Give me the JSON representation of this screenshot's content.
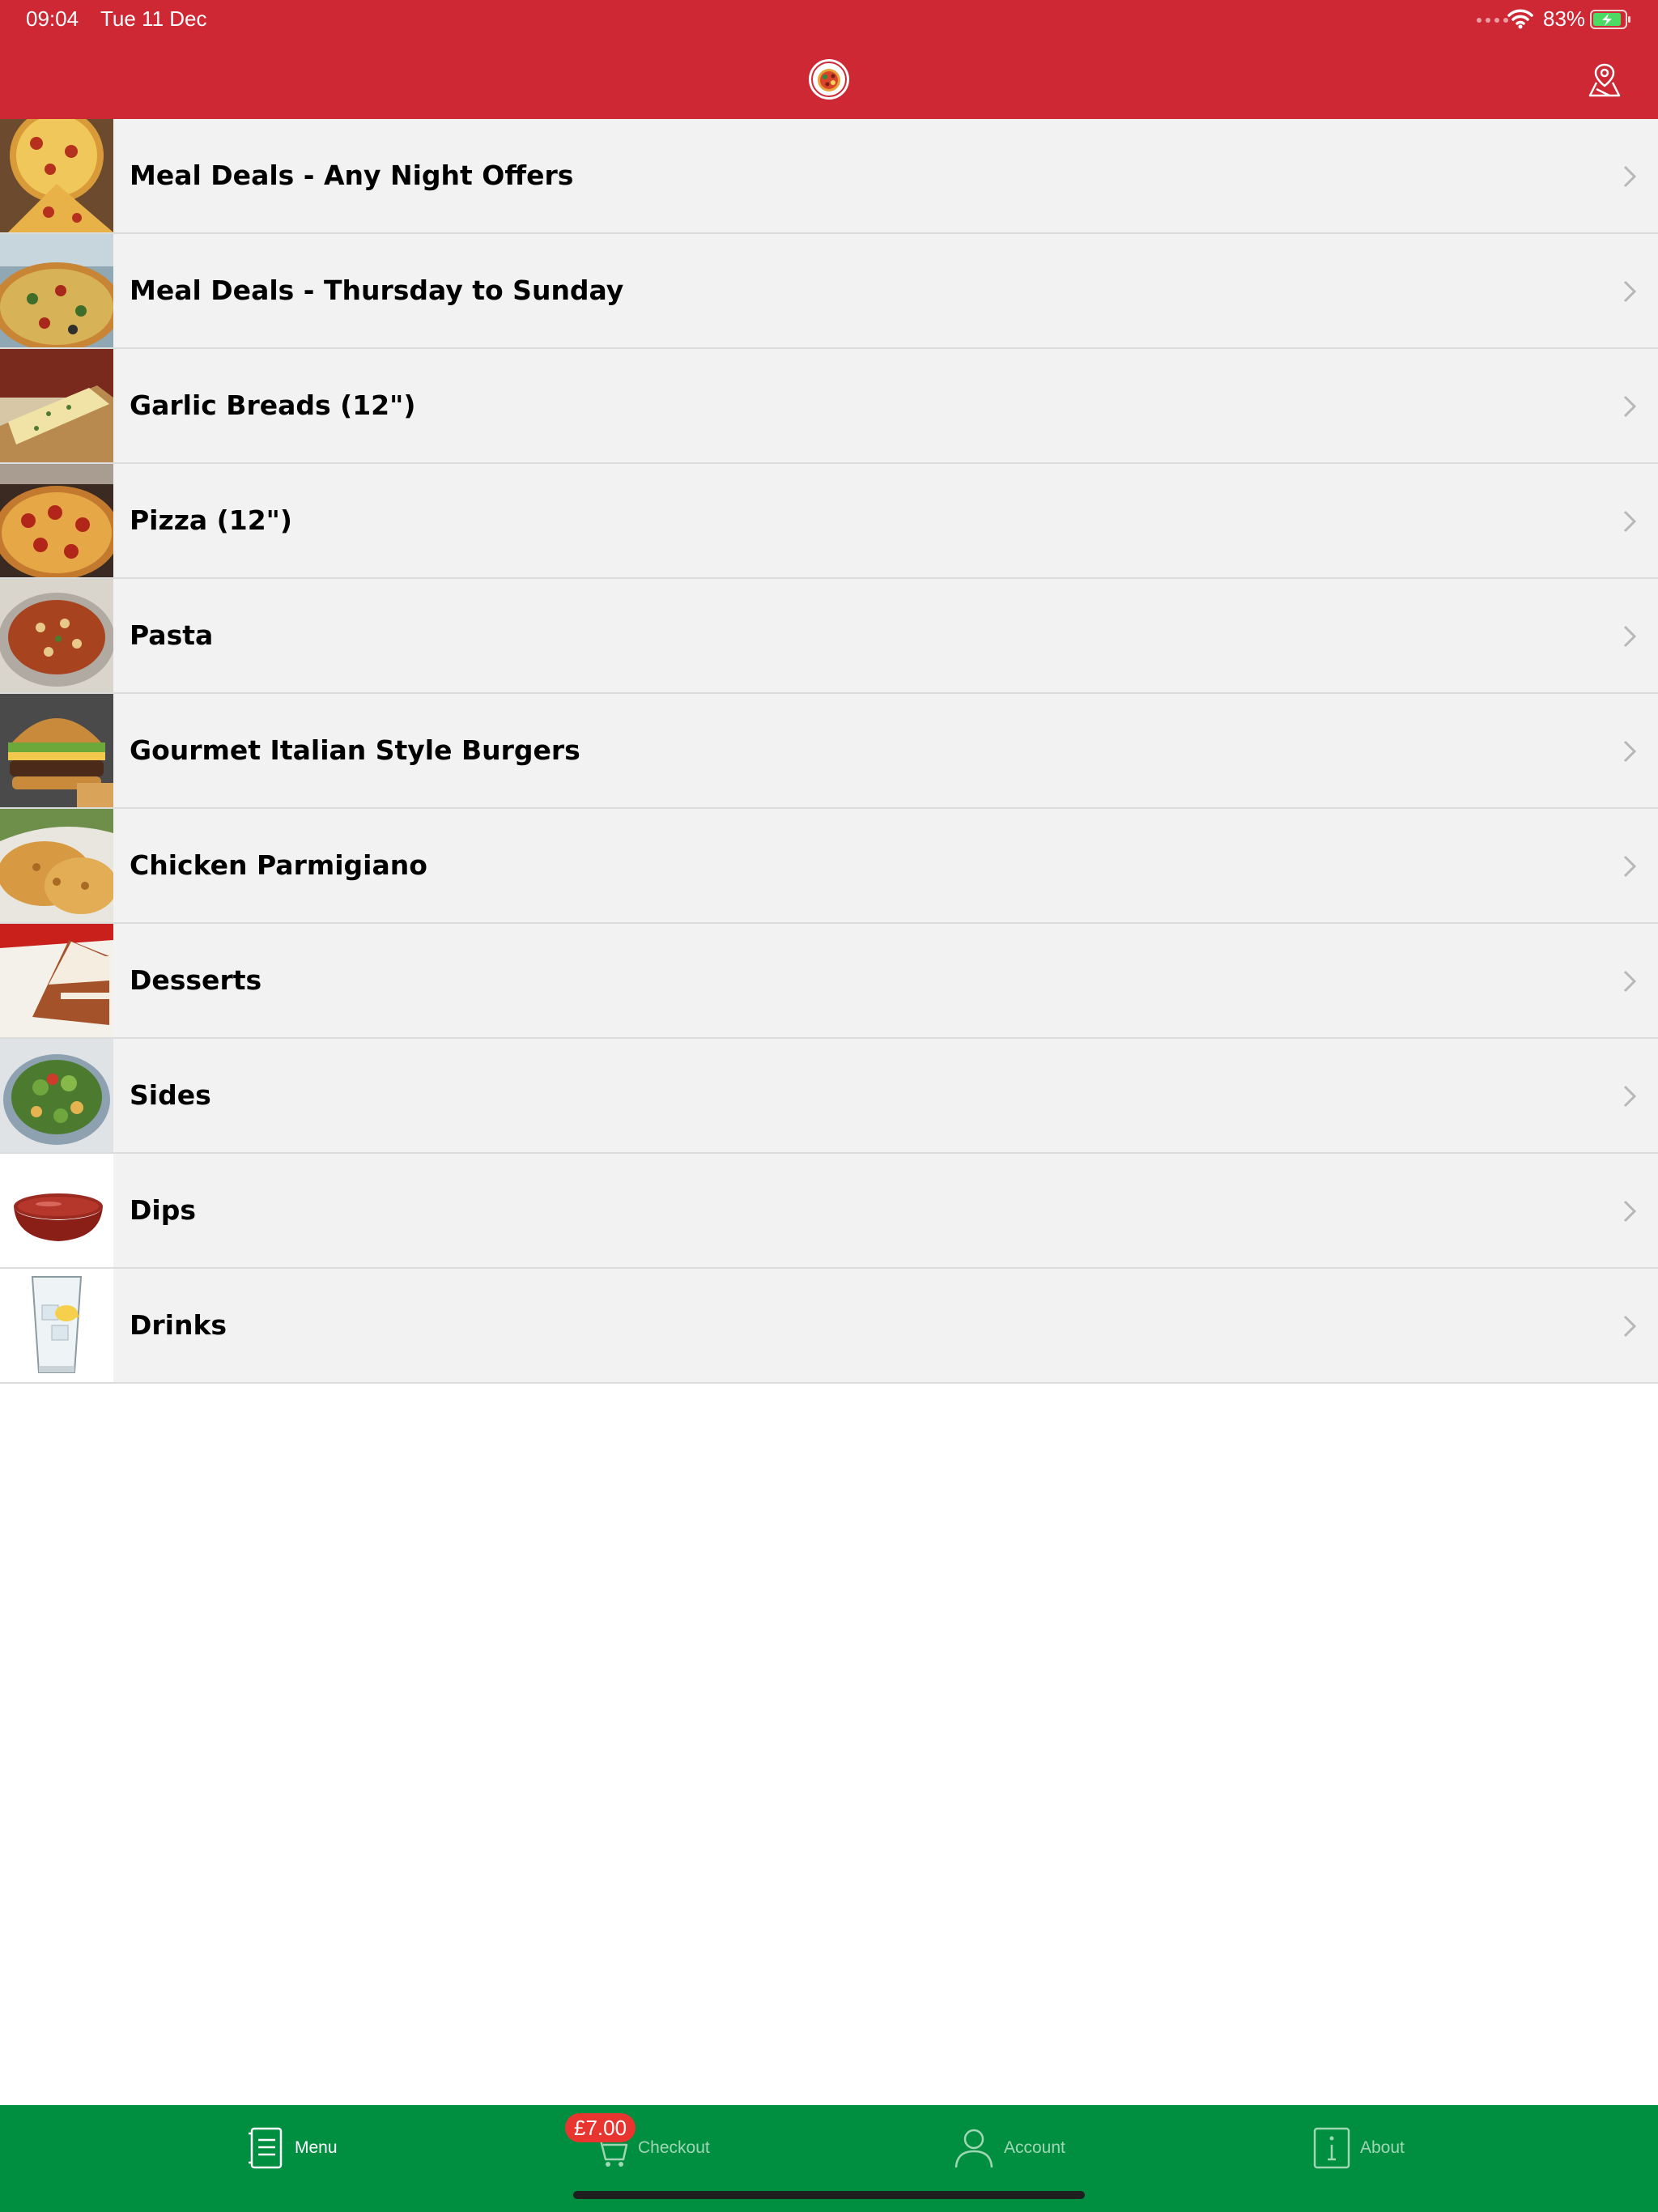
{
  "status_bar": {
    "time": "09:04",
    "date": "Tue 11 Dec",
    "battery": "83%"
  },
  "header": {
    "logo_icon": "pizza-logo-icon",
    "location_icon": "map-pin-icon"
  },
  "categories": [
    {
      "label": "Meal Deals - Any Night Offers",
      "thumb": "pizza-slices"
    },
    {
      "label": "Meal Deals - Thursday to Sunday",
      "thumb": "pizza-pan"
    },
    {
      "label": "Garlic Breads (12\")",
      "thumb": "garlic-bread"
    },
    {
      "label": "Pizza (12\")",
      "thumb": "pepperoni-pizza"
    },
    {
      "label": "Pasta",
      "thumb": "pasta-bowl"
    },
    {
      "label": "Gourmet Italian Style Burgers",
      "thumb": "burger"
    },
    {
      "label": "Chicken Parmigiano",
      "thumb": "chicken"
    },
    {
      "label": "Desserts",
      "thumb": "cake"
    },
    {
      "label": "Sides",
      "thumb": "salad"
    },
    {
      "label": "Dips",
      "thumb": "dip-bowl"
    },
    {
      "label": "Drinks",
      "thumb": "water-glass"
    }
  ],
  "tab_bar": {
    "tabs": [
      {
        "label": "Menu",
        "icon": "menu-icon",
        "active": true
      },
      {
        "label": "Checkout",
        "icon": "cart-icon",
        "active": false
      },
      {
        "label": "Account",
        "icon": "user-icon",
        "active": false
      },
      {
        "label": "About",
        "icon": "info-icon",
        "active": false
      }
    ],
    "cart_total": "£7.00"
  },
  "colors": {
    "header_red": "#cf2835",
    "tab_green": "#008f40",
    "badge_red": "#e8352f",
    "row_background": "#f2f2f2"
  }
}
